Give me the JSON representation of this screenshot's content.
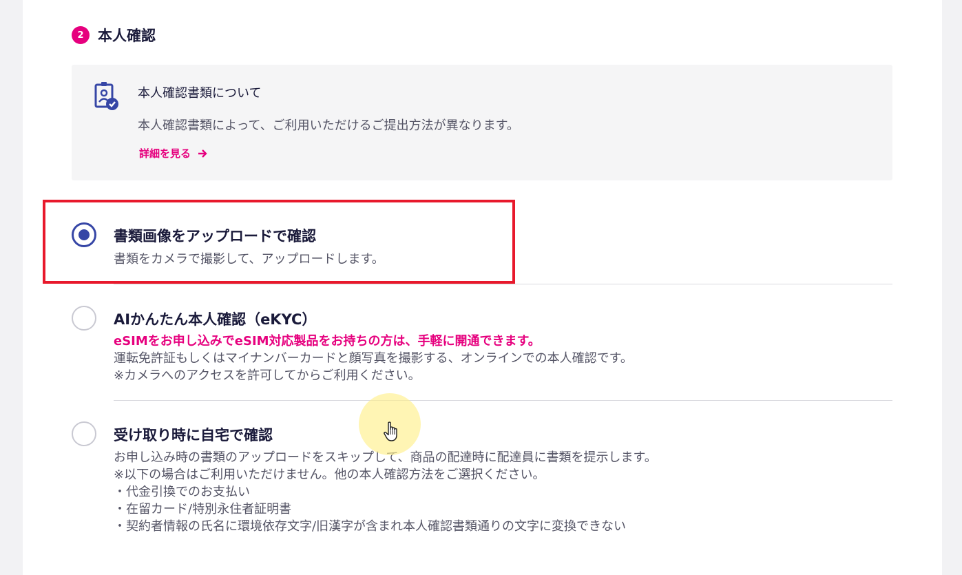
{
  "section": {
    "step_number": "2",
    "title": "本人確認"
  },
  "info_box": {
    "icon": "id-badge-check-icon",
    "title": "本人確認書類について",
    "description": "本人確認書類によって、ご利用いただけるご提出方法が異なります。",
    "link_label": "詳細を見る",
    "link_icon": "arrow-right-icon"
  },
  "options": [
    {
      "title": "書類画像をアップロードで確認",
      "selected": true,
      "lines": [
        "書類をカメラで撮影して、アップロードします。"
      ]
    },
    {
      "title": "AIかんたん本人確認（eKYC）",
      "selected": false,
      "emphasis": "eSIMをお申し込みでeSIM対応製品をお持ちの方は、手軽に開通できます。",
      "lines": [
        "運転免許証もしくはマイナンバーカードと顔写真を撮影する、オンラインでの本人確認です。",
        "※カメラへのアクセスを許可してからご利用ください。"
      ]
    },
    {
      "title": "受け取り時に自宅で確認",
      "selected": false,
      "lines": [
        "お申し込み時の書類のアップロードをスキップして、商品の配達時に配達員に書類を提示します。",
        "※以下の場合はご利用いただけません。他の本人確認方法をご選択ください。",
        "・代金引換でのお支払い",
        "・在留カード/特別永住者証明書",
        "・契約者情報の氏名に環境依存文字/旧漢字が含まれ本人確認書類通りの文字に変換できない"
      ]
    }
  ],
  "colors": {
    "accent_pink": "#e6007e",
    "radio_selected": "#3646a6",
    "highlight_red": "#e8192c",
    "text_dark": "#1a1a3a",
    "text_body": "#555566"
  }
}
